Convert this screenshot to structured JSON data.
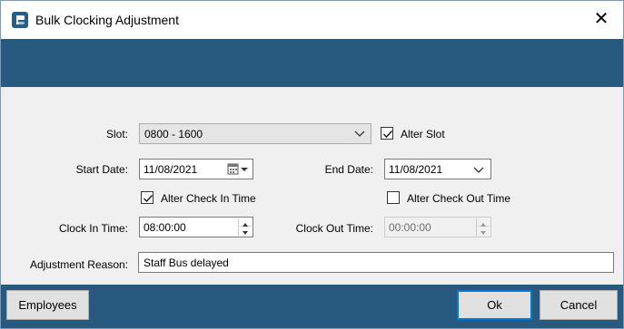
{
  "window": {
    "title": "Bulk Clocking Adjustment",
    "close_glyph": "✕",
    "accent_color": "#285a7f"
  },
  "form": {
    "slot": {
      "label": "Slot:",
      "value": "0800 - 1600"
    },
    "alter_slot": {
      "label": "Alter Slot",
      "checked": true
    },
    "start_date": {
      "label": "Start Date:",
      "value": "11/08/2021"
    },
    "end_date": {
      "label": "End Date:",
      "value": "11/08/2021"
    },
    "alter_check_in": {
      "label": "Alter Check In Time",
      "checked": true
    },
    "alter_check_out": {
      "label": "Alter Check Out Time",
      "checked": false
    },
    "clock_in": {
      "label": "Clock In Time:",
      "value": "08:00:00"
    },
    "clock_out": {
      "label": "Clock Out Time:",
      "value": "00:00:00",
      "enabled": false
    },
    "adjustment_reason": {
      "label": "Adjustment Reason:",
      "value": "Staff Bus delayed"
    }
  },
  "buttons": {
    "employees": "Employees",
    "ok": "Ok",
    "cancel": "Cancel"
  },
  "icons": {
    "app": "app-logo-icon",
    "calendar": "calendar-icon",
    "dropdown": "chevron-down-icon",
    "spinner": "spinner-arrows-icon",
    "check": "check-icon"
  }
}
